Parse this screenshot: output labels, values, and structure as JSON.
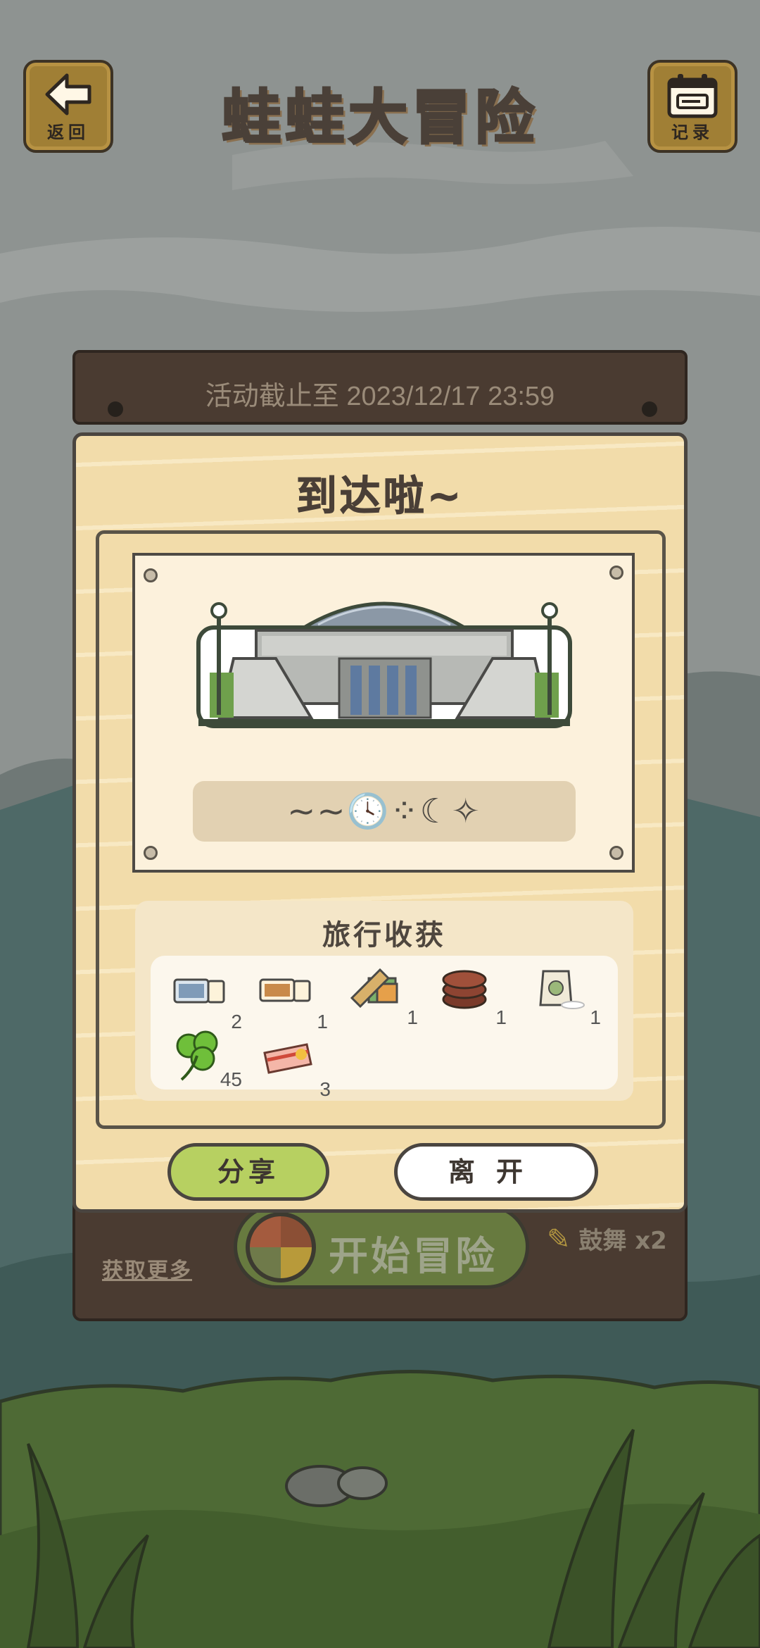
{
  "header": {
    "title": "蛙蛙大冒险",
    "back_label": "返回",
    "record_label": "记录"
  },
  "board": {
    "deadline": "活动截止至 2023/12/17 23:59",
    "more_link": "获取更多",
    "start_label": "开始冒险",
    "drum_label": "鼓舞",
    "drum_count": "x2"
  },
  "dialog": {
    "title": "到达啦~",
    "clue_text": "~~🕓⁘☾✧",
    "harvest_title": "旅行收获",
    "items": [
      {
        "icon": "ticket-photo-icon",
        "qty": "2"
      },
      {
        "icon": "ticket-orange-icon",
        "qty": "1"
      },
      {
        "icon": "wood-log-icon",
        "qty": "1"
      },
      {
        "icon": "sausage-stack-icon",
        "qty": "1"
      },
      {
        "icon": "flour-bag-icon",
        "qty": "1"
      },
      {
        "icon": "clover-icon",
        "qty": "45"
      },
      {
        "icon": "bacon-icon",
        "qty": "3"
      }
    ],
    "share_label": "分享",
    "leave_label": "离开"
  },
  "colors": {
    "share_button": "#b7d061",
    "dialog_bg": "#f2dcaa",
    "board": "#4a3b31"
  }
}
